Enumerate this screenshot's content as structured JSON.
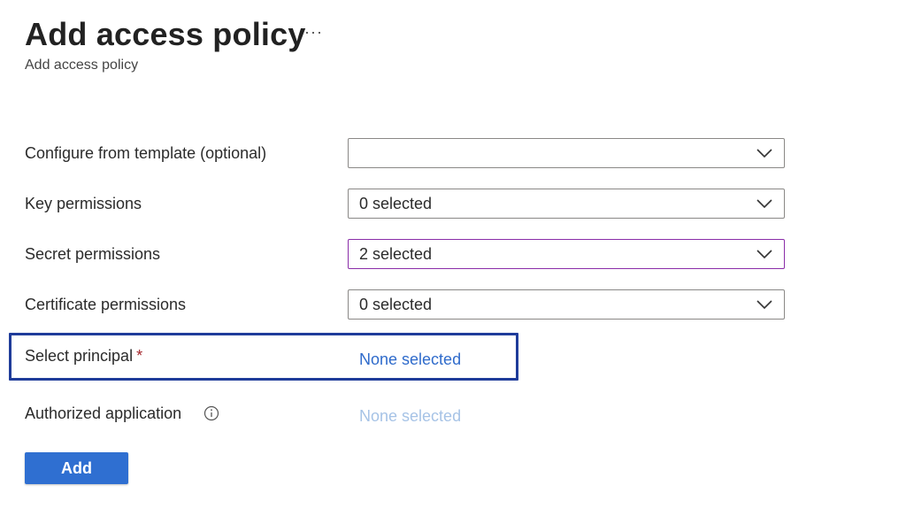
{
  "page": {
    "title": "Add access policy",
    "subtitle": "Add access policy",
    "more_menu_glyph": "···",
    "top_partial_text": "y"
  },
  "form": {
    "template": {
      "label": "Configure from template (optional)",
      "value": ""
    },
    "key_permissions": {
      "label": "Key permissions",
      "value": "0 selected"
    },
    "secret_permissions": {
      "label": "Secret permissions",
      "value": "2 selected"
    },
    "certificate_permissions": {
      "label": "Certificate permissions",
      "value": "0 selected"
    },
    "principal": {
      "label": "Select principal",
      "required_mark": "*",
      "value": "None selected"
    },
    "authorized_application": {
      "label": "Authorized application",
      "value": "None selected",
      "icon": "info-icon"
    }
  },
  "actions": {
    "add_label": "Add"
  },
  "colors": {
    "link": "#2f6bcb",
    "link_disabled": "#a6c3e6",
    "primary_button": "#2f6fd1",
    "highlight_box": "#1f3c9a",
    "active_dropdown_border": "#8a2da8",
    "required": "#a4262c"
  }
}
